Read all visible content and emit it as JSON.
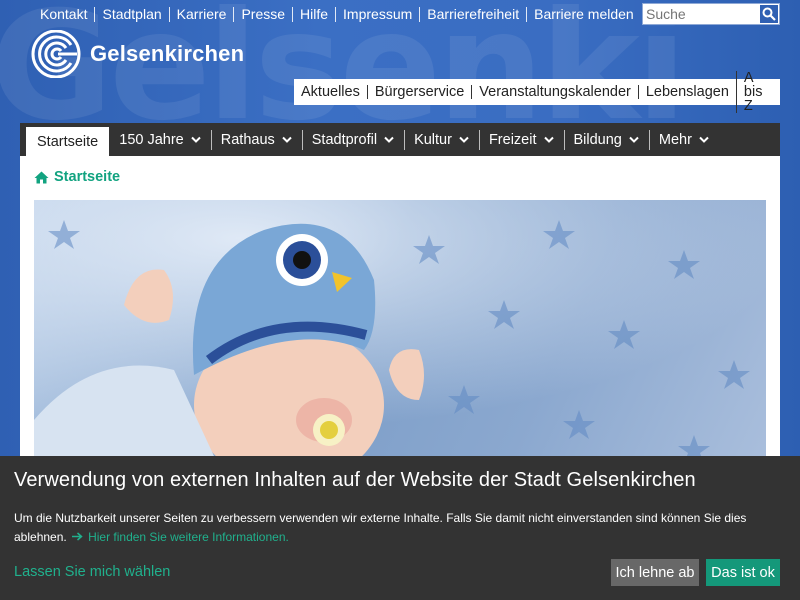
{
  "header": {
    "service_links": [
      "Kontakt",
      "Stadtplan",
      "Karriere",
      "Presse",
      "Hilfe",
      "Impressum",
      "Barrierefreiheit",
      "Barriere melden"
    ],
    "search_placeholder": "Suche",
    "logo_text": "Gelsenkirchen",
    "quick_links": [
      "Aktuelles",
      "Bürgerservice",
      "Veranstaltungskalender",
      "Lebenslagen",
      "A bis Z"
    ]
  },
  "main_nav": {
    "items": [
      "Startseite",
      "150 Jahre",
      "Rathaus",
      "Stadtprofil",
      "Kultur",
      "Freizeit",
      "Bildung",
      "Mehr"
    ],
    "active_index": 0
  },
  "breadcrumb": {
    "label": "Startseite"
  },
  "cookie_banner": {
    "title": "Verwendung von externen Inhalten auf der Website der Stadt Gelsenkirchen",
    "text": "Um die Nutzbarkeit unserer Seiten zu verbessern verwenden wir externe Inhalte. Falls Sie damit nicht einverstanden sind können Sie dies ablehnen.",
    "more_link": "Hier finden Sie weitere Informationen.",
    "choose_link": "Lassen Sie mich wählen",
    "decline_button": "Ich lehne ab",
    "accept_button": "Das ist ok"
  },
  "colors": {
    "header_blue": "#3b6fc4",
    "nav_dark": "#333333",
    "accent_green": "#14987a",
    "decline_gray": "#686868"
  },
  "icons": {
    "search": "search-icon",
    "home": "home-icon",
    "chevron": "chevron-down-icon",
    "arrow": "arrow-right-icon"
  }
}
